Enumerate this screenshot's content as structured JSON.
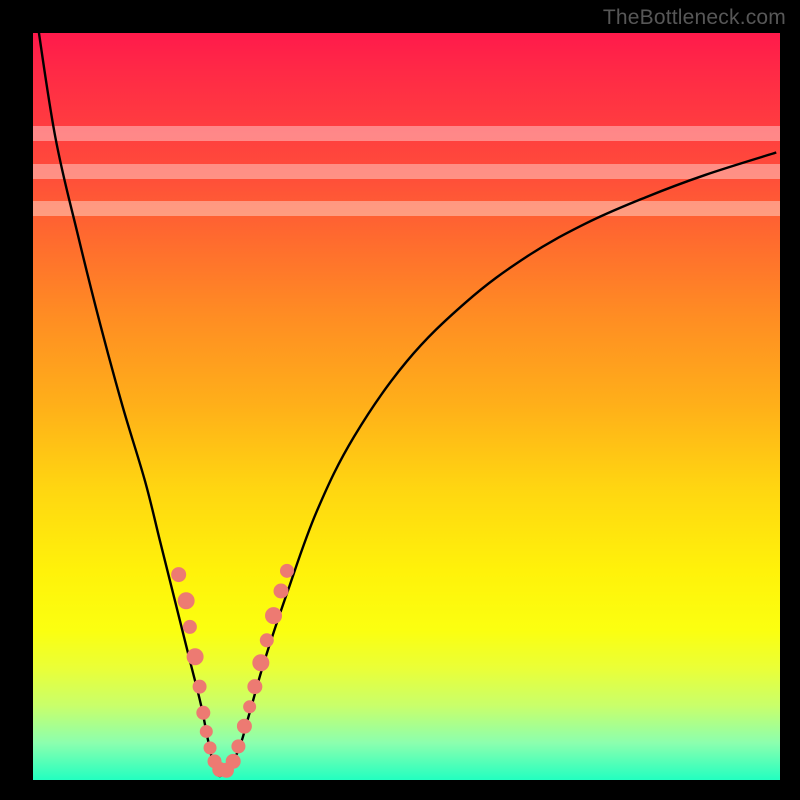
{
  "watermark": "TheBottleneck.com",
  "chart_data": {
    "type": "line",
    "title": "",
    "xlabel": "",
    "ylabel": "",
    "xlim": [
      0,
      100
    ],
    "ylim": [
      0,
      100
    ],
    "series": [
      {
        "name": "curve",
        "x": [
          0.5,
          3,
          6,
          9,
          12,
          15,
          17,
          19,
          21,
          22.5,
          23.5,
          24.5,
          25.7,
          27.5,
          29,
          31,
          34,
          38,
          43,
          50,
          58,
          66,
          74,
          82,
          90,
          99.5
        ],
        "values": [
          102,
          86,
          73,
          61,
          50,
          40,
          32,
          24,
          16,
          10,
          5,
          1,
          1,
          4,
          9,
          16,
          25,
          36,
          46,
          56,
          64,
          70,
          74.5,
          78,
          81,
          84
        ]
      }
    ],
    "markers": [
      {
        "x": 19.5,
        "y": 27.5,
        "r": 7
      },
      {
        "x": 20.5,
        "y": 24,
        "r": 8
      },
      {
        "x": 21,
        "y": 20.5,
        "r": 6.5
      },
      {
        "x": 21.7,
        "y": 16.5,
        "r": 8
      },
      {
        "x": 22.3,
        "y": 12.5,
        "r": 6.5
      },
      {
        "x": 22.8,
        "y": 9,
        "r": 6.5
      },
      {
        "x": 23.2,
        "y": 6.5,
        "r": 6
      },
      {
        "x": 23.7,
        "y": 4.3,
        "r": 6
      },
      {
        "x": 24.3,
        "y": 2.5,
        "r": 6.5
      },
      {
        "x": 25,
        "y": 1.4,
        "r": 7
      },
      {
        "x": 25.9,
        "y": 1.3,
        "r": 7
      },
      {
        "x": 26.8,
        "y": 2.5,
        "r": 7
      },
      {
        "x": 27.5,
        "y": 4.5,
        "r": 6.5
      },
      {
        "x": 28.3,
        "y": 7.2,
        "r": 7
      },
      {
        "x": 29,
        "y": 9.8,
        "r": 6
      },
      {
        "x": 29.7,
        "y": 12.5,
        "r": 7
      },
      {
        "x": 30.5,
        "y": 15.7,
        "r": 8
      },
      {
        "x": 31.3,
        "y": 18.7,
        "r": 6.5
      },
      {
        "x": 32.2,
        "y": 22,
        "r": 8
      },
      {
        "x": 33.2,
        "y": 25.3,
        "r": 7
      },
      {
        "x": 34,
        "y": 28,
        "r": 6.5
      }
    ],
    "white_bands": [
      {
        "y_from": 75.5,
        "y_to": 77.5
      },
      {
        "y_from": 80.5,
        "y_to": 82.5
      },
      {
        "y_from": 85.5,
        "y_to": 87.5
      }
    ],
    "colors": {
      "curve": "#000000",
      "marker_fill": "#ed7a72",
      "marker_stroke": "#ed7a72"
    }
  }
}
